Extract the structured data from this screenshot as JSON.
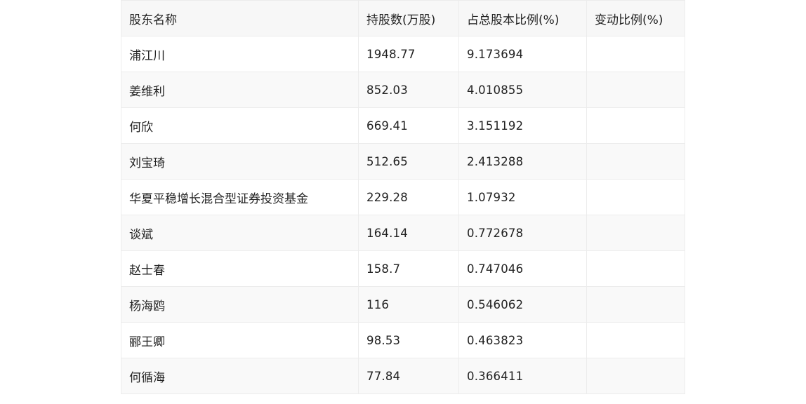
{
  "table": {
    "headers": [
      "股东名称",
      "持股数(万股)",
      "占总股本比例(%)",
      "变动比例(%)"
    ],
    "rows": [
      {
        "name": "浦江川",
        "shares": "1948.77",
        "ratio": "9.173694",
        "change": ""
      },
      {
        "name": "姜维利",
        "shares": "852.03",
        "ratio": "4.010855",
        "change": ""
      },
      {
        "name": "何欣",
        "shares": "669.41",
        "ratio": "3.151192",
        "change": ""
      },
      {
        "name": "刘宝琦",
        "shares": "512.65",
        "ratio": "2.413288",
        "change": ""
      },
      {
        "name": "华夏平稳增长混合型证券投资基金",
        "shares": "229.28",
        "ratio": "1.07932",
        "change": ""
      },
      {
        "name": "谈斌",
        "shares": "164.14",
        "ratio": "0.772678",
        "change": ""
      },
      {
        "name": "赵士春",
        "shares": "158.7",
        "ratio": "0.747046",
        "change": ""
      },
      {
        "name": "杨海鸥",
        "shares": "116",
        "ratio": "0.546062",
        "change": ""
      },
      {
        "name": "郦王卿",
        "shares": "98.53",
        "ratio": "0.463823",
        "change": ""
      },
      {
        "name": "何循海",
        "shares": "77.84",
        "ratio": "0.366411",
        "change": ""
      }
    ]
  }
}
